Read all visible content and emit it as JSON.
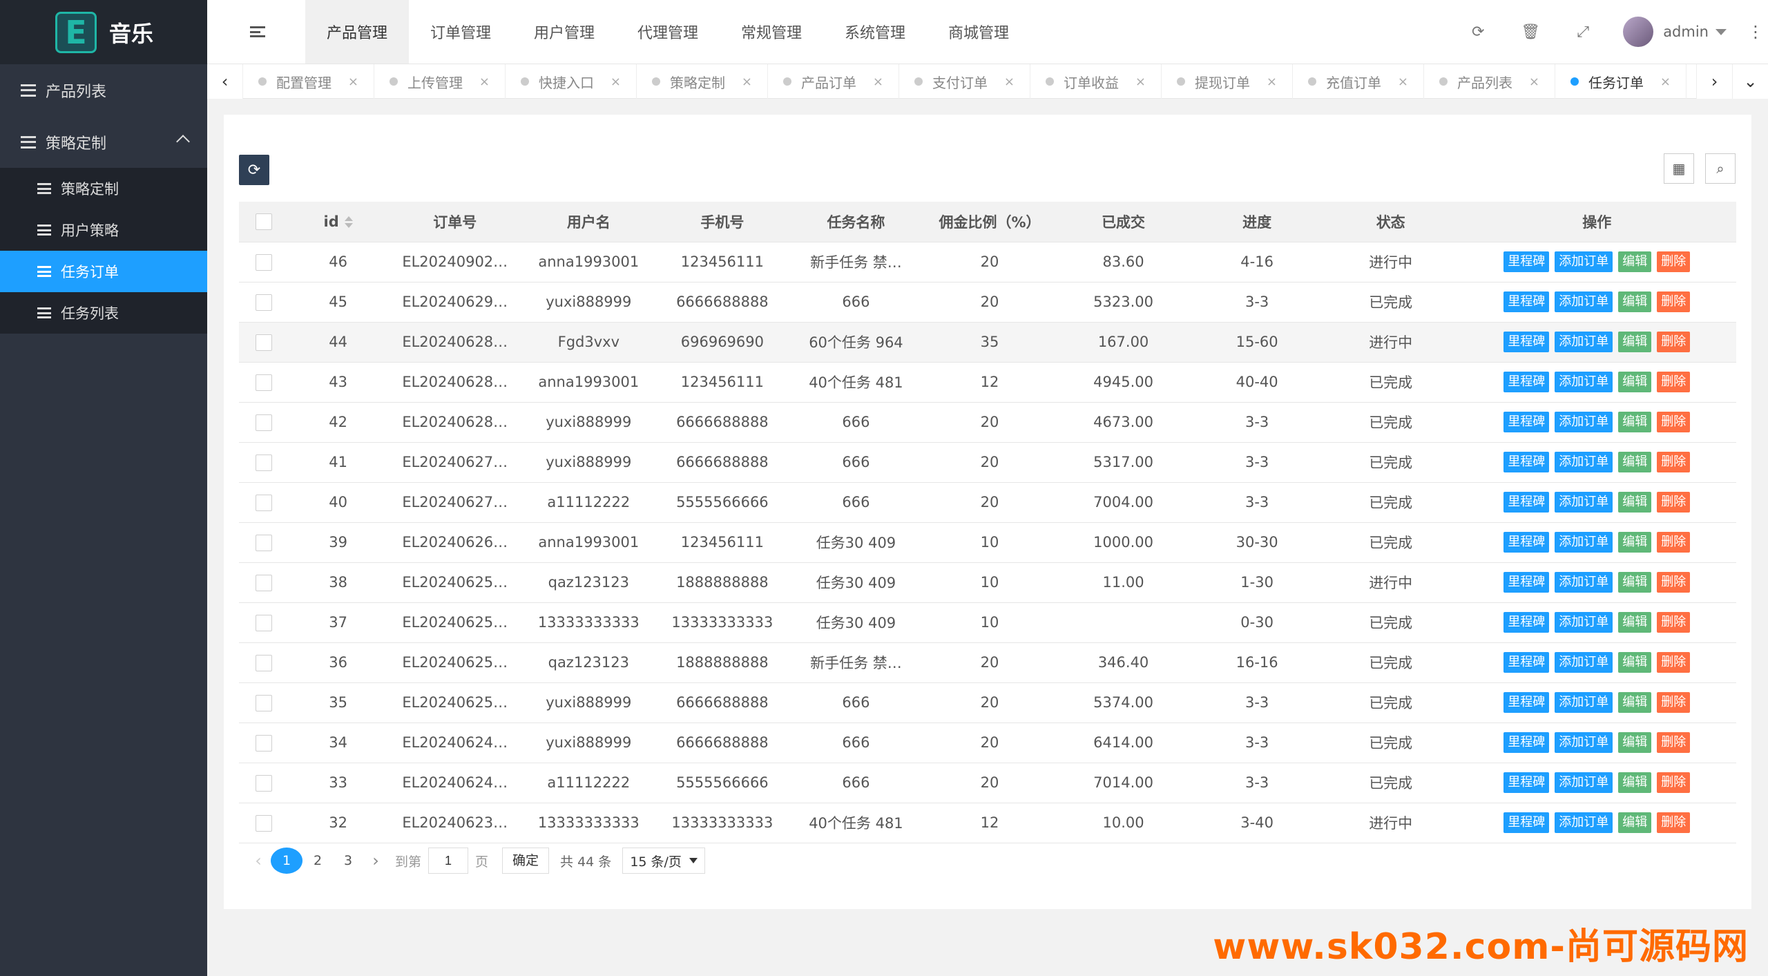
{
  "brand": {
    "mark": "E",
    "name": "音乐"
  },
  "sidebar": {
    "items": [
      {
        "label": "产品列表"
      },
      {
        "label": "策略定制"
      }
    ],
    "sub_items": [
      {
        "label": "策略定制"
      },
      {
        "label": "用户策略"
      },
      {
        "label": "任务订单",
        "active": true
      },
      {
        "label": "任务列表"
      }
    ]
  },
  "topnav": [
    "产品管理",
    "订单管理",
    "用户管理",
    "代理管理",
    "常规管理",
    "系统管理",
    "商城管理"
  ],
  "topnav_active": "产品管理",
  "header": {
    "username": "admin",
    "icons": [
      "refresh-icon",
      "trash-icon",
      "fullscreen-icon"
    ]
  },
  "tabs": [
    {
      "label": "配置管理"
    },
    {
      "label": "上传管理"
    },
    {
      "label": "快捷入口"
    },
    {
      "label": "策略定制"
    },
    {
      "label": "产品订单"
    },
    {
      "label": "支付订单"
    },
    {
      "label": "订单收益"
    },
    {
      "label": "提现订单"
    },
    {
      "label": "充值订单"
    },
    {
      "label": "产品列表"
    },
    {
      "label": "任务订单",
      "active": true
    }
  ],
  "table": {
    "columns": [
      "id",
      "订单号",
      "用户名",
      "手机号",
      "任务名称",
      "佣金比例（%）",
      "已成交",
      "进度",
      "状态",
      "操作"
    ],
    "actions": [
      "里程碑",
      "添加订单",
      "编辑",
      "删除"
    ],
    "rows": [
      [
        "46",
        "EL20240902…",
        "anna1993001",
        "123456111",
        "新手任务 禁…",
        "20",
        "83.60",
        "4-16",
        "进行中"
      ],
      [
        "45",
        "EL20240629…",
        "yuxi888999",
        "6666688888",
        "666",
        "20",
        "5323.00",
        "3-3",
        "已完成"
      ],
      [
        "44",
        "EL20240628…",
        "Fgd3vxv",
        "696969690",
        "60个任务 964",
        "35",
        "167.00",
        "15-60",
        "进行中"
      ],
      [
        "43",
        "EL20240628…",
        "anna1993001",
        "123456111",
        "40个任务 481",
        "12",
        "4945.00",
        "40-40",
        "已完成"
      ],
      [
        "42",
        "EL20240628…",
        "yuxi888999",
        "6666688888",
        "666",
        "20",
        "4673.00",
        "3-3",
        "已完成"
      ],
      [
        "41",
        "EL20240627…",
        "yuxi888999",
        "6666688888",
        "666",
        "20",
        "5317.00",
        "3-3",
        "已完成"
      ],
      [
        "40",
        "EL20240627…",
        "a11112222",
        "5555566666",
        "666",
        "20",
        "7004.00",
        "3-3",
        "已完成"
      ],
      [
        "39",
        "EL20240626…",
        "anna1993001",
        "123456111",
        "任务30 409",
        "10",
        "1000.00",
        "30-30",
        "已完成"
      ],
      [
        "38",
        "EL20240625…",
        "qaz123123",
        "1888888888",
        "任务30 409",
        "10",
        "11.00",
        "1-30",
        "进行中"
      ],
      [
        "37",
        "EL20240625…",
        "13333333333",
        "13333333333",
        "任务30 409",
        "10",
        "",
        "0-30",
        "已完成"
      ],
      [
        "36",
        "EL20240625…",
        "qaz123123",
        "1888888888",
        "新手任务 禁…",
        "20",
        "346.40",
        "16-16",
        "已完成"
      ],
      [
        "35",
        "EL20240625…",
        "yuxi888999",
        "6666688888",
        "666",
        "20",
        "5374.00",
        "3-3",
        "已完成"
      ],
      [
        "34",
        "EL20240624…",
        "yuxi888999",
        "6666688888",
        "666",
        "20",
        "6414.00",
        "3-3",
        "已完成"
      ],
      [
        "33",
        "EL20240624…",
        "a11112222",
        "5555566666",
        "666",
        "20",
        "7014.00",
        "3-3",
        "已完成"
      ],
      [
        "32",
        "EL20240623…",
        "13333333333",
        "13333333333",
        "40个任务 481",
        "12",
        "10.00",
        "3-40",
        "进行中"
      ]
    ]
  },
  "pager": {
    "pages": [
      "1",
      "2",
      "3"
    ],
    "current": "1",
    "goto_label": "到第",
    "goto_value": "1",
    "page_label": "页",
    "confirm": "确定",
    "total": "共 44 条",
    "page_size": "15 条/页"
  },
  "watermark": "www.sk032.com-尚可源码网"
}
